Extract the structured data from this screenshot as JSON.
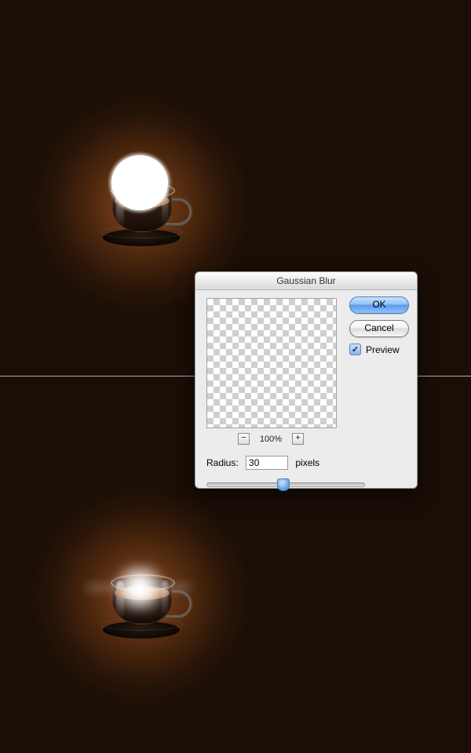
{
  "dialog": {
    "title": "Gaussian Blur",
    "ok_label": "OK",
    "cancel_label": "Cancel",
    "preview_label": "Preview",
    "preview_checked": true,
    "zoom_out": "−",
    "zoom_in": "+",
    "zoom_level": "100%",
    "radius_label": "Radius:",
    "radius_value": "30",
    "radius_unit": "pixels"
  }
}
